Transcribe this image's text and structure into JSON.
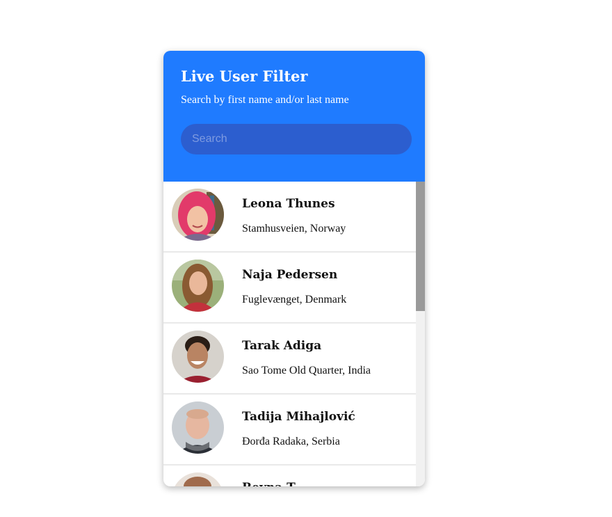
{
  "header": {
    "title": "Live User Filter",
    "subtitle": "Search by first name and/or last name"
  },
  "search": {
    "placeholder": "Search",
    "value": ""
  },
  "users": [
    {
      "name": "Leona Thunes",
      "location": "Stamhusveien, Norway",
      "avatar": "woman-pink-hair-avatar"
    },
    {
      "name": "Naja Pedersen",
      "location": "Fuglevænget, Denmark",
      "avatar": "woman-long-hair-avatar"
    },
    {
      "name": "Tarak Adiga",
      "location": "Sao Tome Old Quarter, India",
      "avatar": "man-smiling-avatar",
      "selected": true
    },
    {
      "name": "Tadija Mihajlović",
      "location": "Đorđa Radaka, Serbia",
      "avatar": "man-scarf-avatar"
    },
    {
      "name": "Reyna T",
      "location": "",
      "avatar": "partial-avatar"
    }
  ],
  "colors": {
    "header_bg": "#1f7bff",
    "search_bg": "#2c5ecf",
    "selection_bg": "#3a8ff5"
  }
}
